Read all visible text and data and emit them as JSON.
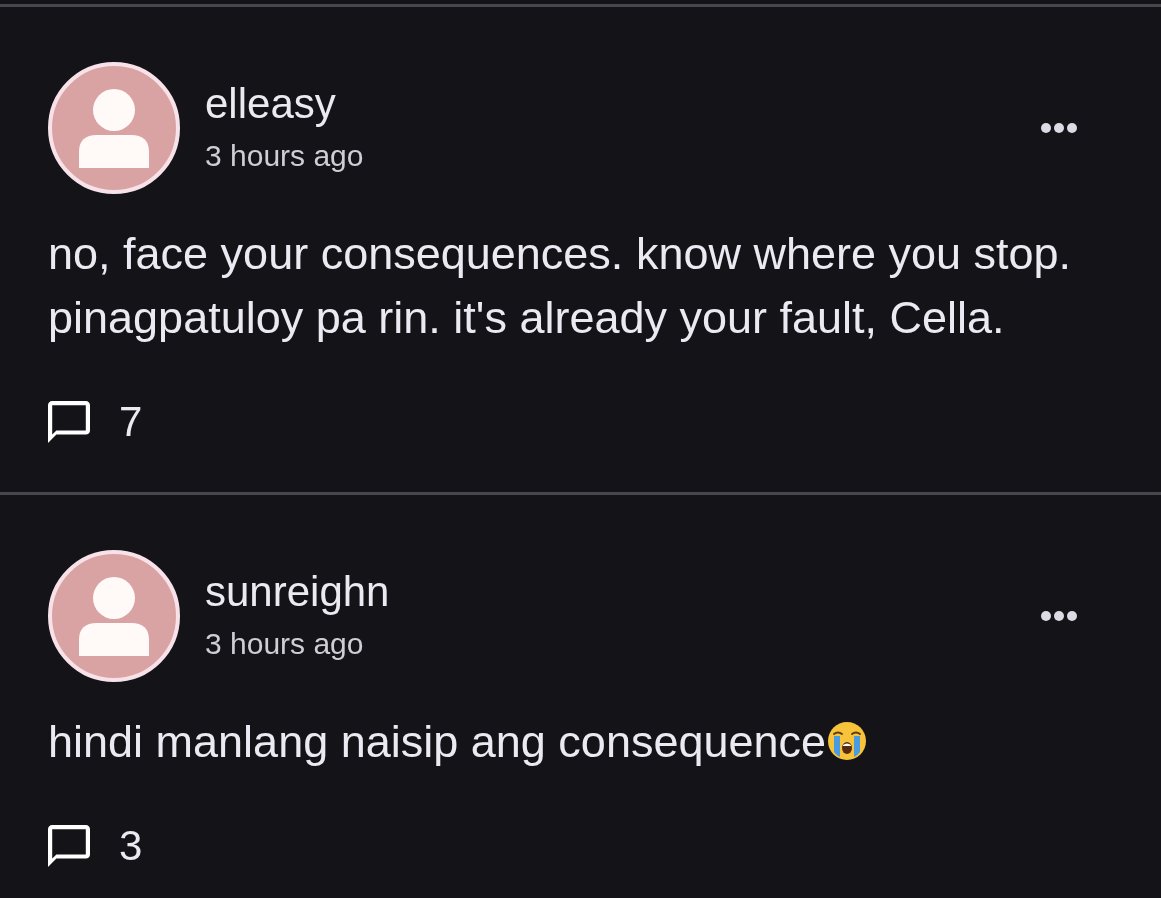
{
  "posts": [
    {
      "author": "elleasy",
      "time": "3 hours ago",
      "body": "no, face your consequences. know where you stop. pinagpatuloy pa rin. it's already your fault, Cella.",
      "comment_count": "7"
    },
    {
      "author": "sunreighn",
      "time": "3 hours ago",
      "body": "hindi manlang naisip ang consequence",
      "emoji": {
        "kind": "loudly-crying-face"
      },
      "comment_count": "3"
    }
  ]
}
